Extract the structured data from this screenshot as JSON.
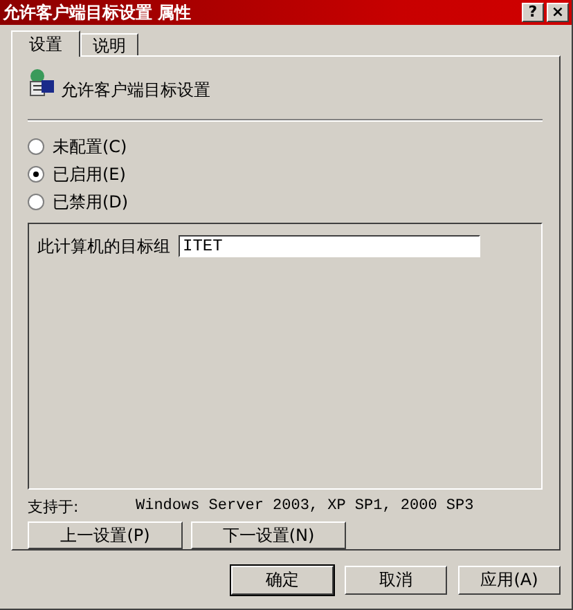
{
  "window": {
    "title": "允许客户端目标设置 属性"
  },
  "title_buttons": [
    {
      "label": "?"
    },
    {
      "label": "×"
    }
  ],
  "tabs": [
    {
      "label": "设置",
      "selected": true
    },
    {
      "label": "说明",
      "selected": false
    }
  ],
  "setting": {
    "name": "允许客户端目标设置"
  },
  "options": [
    {
      "label": "未配置(C)",
      "selected": false
    },
    {
      "label": "已启用(E)",
      "selected": true
    },
    {
      "label": "已禁用(D)",
      "selected": false
    }
  ],
  "group": {
    "label": "此计算机的目标组",
    "value": "ITET"
  },
  "supported": {
    "label": "支持于:",
    "value": "Windows Server 2003, XP SP1, 2000 SP3"
  },
  "nav_buttons": [
    "上一设置(P)",
    "下一设置(N)"
  ],
  "buttons": [
    {
      "label": "确定",
      "default": true
    },
    {
      "label": "取消",
      "default": false
    },
    {
      "label": "应用(A)",
      "default": false
    }
  ]
}
